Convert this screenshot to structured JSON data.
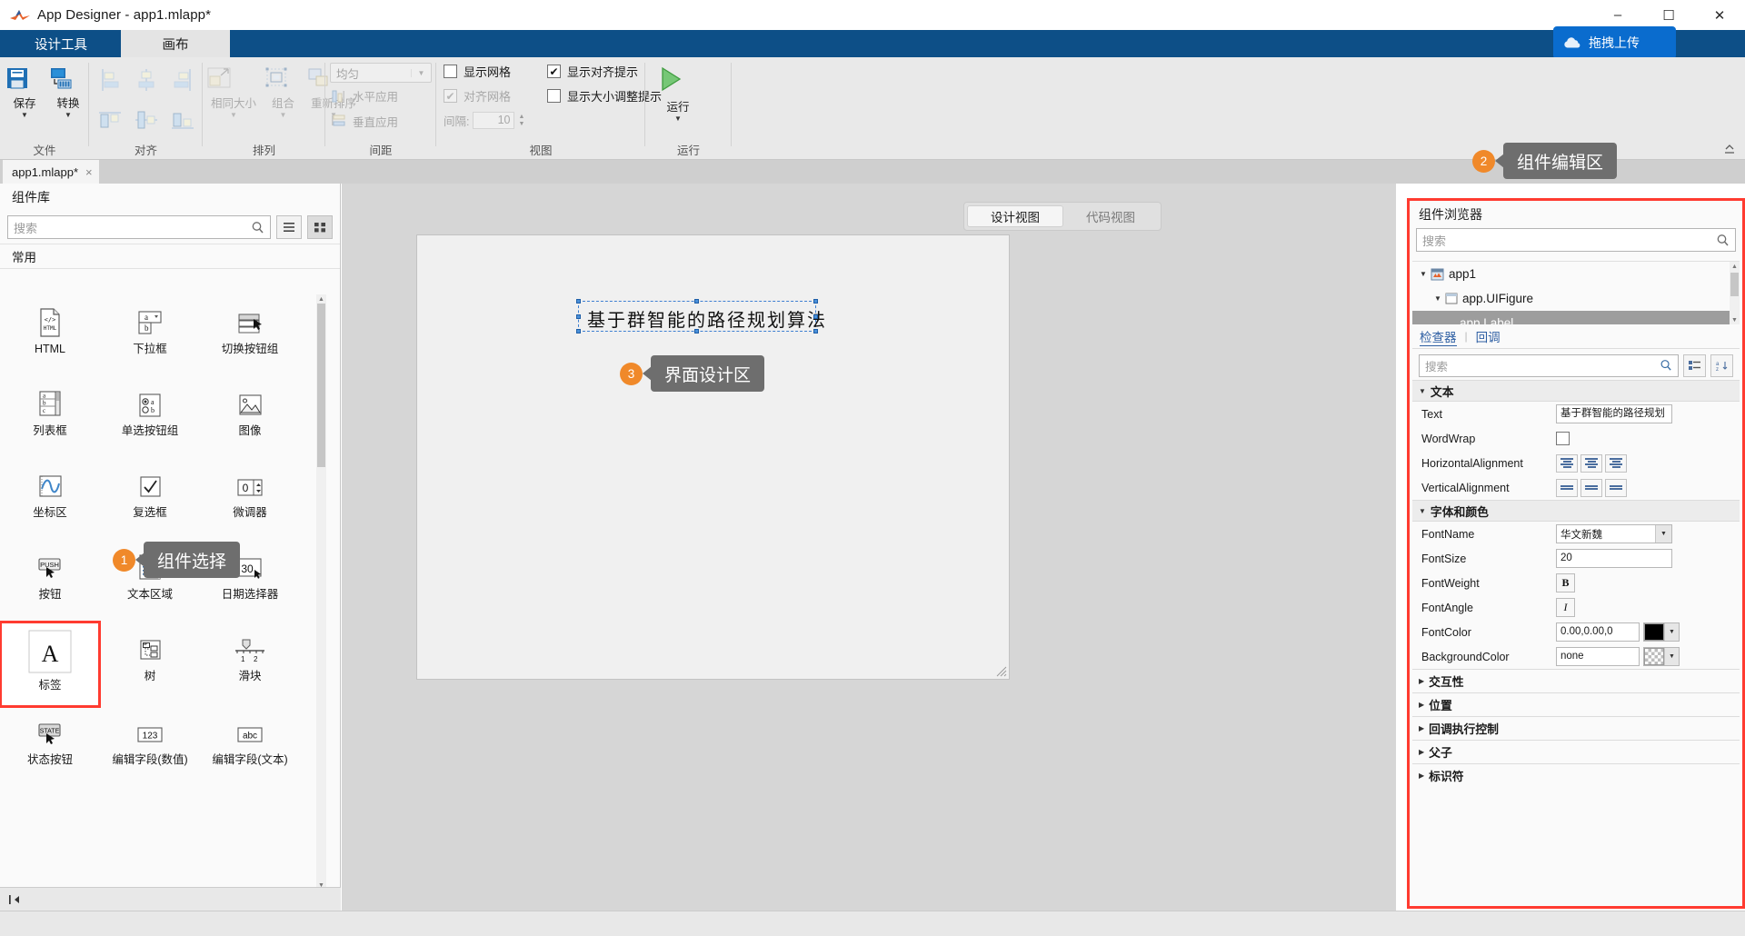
{
  "window": {
    "title": "App Designer - app1.mlapp*",
    "app_icon": "matlab-icon",
    "minimize": "–",
    "maximize": "☐",
    "close": "✕"
  },
  "ribbon": {
    "tabs": [
      {
        "label": "设计工具",
        "active": false
      },
      {
        "label": "画布",
        "active": true
      }
    ],
    "groups": [
      {
        "name": "文件",
        "items": [
          {
            "label": "保存",
            "icon": "save-icon",
            "caret": true,
            "disabled": false
          },
          {
            "label": "转换",
            "icon": "convert-icon",
            "caret": true,
            "disabled": false
          }
        ]
      },
      {
        "name": "对齐",
        "items": [
          {
            "label": "",
            "icon": "align-left-icon",
            "disabled": true
          },
          {
            "label": "",
            "icon": "align-center-icon",
            "disabled": true
          },
          {
            "label": "",
            "icon": "align-right-icon",
            "disabled": true
          },
          {
            "label": "",
            "icon": "align-top-icon",
            "disabled": true
          },
          {
            "label": "",
            "icon": "align-middle-icon",
            "disabled": true
          },
          {
            "label": "",
            "icon": "align-bottom-icon",
            "disabled": true
          }
        ]
      },
      {
        "name": "排列",
        "items": [
          {
            "label": "相同大小",
            "icon": "same-size-icon",
            "caret": true,
            "disabled": true
          },
          {
            "label": "组合",
            "icon": "group-icon",
            "caret": true,
            "disabled": true
          },
          {
            "label": "重新排序",
            "icon": "reorder-icon",
            "caret": true,
            "disabled": true
          }
        ]
      },
      {
        "name": "间距",
        "dropdown_value": "均匀",
        "items": [
          {
            "label": "水平应用",
            "icon": "apply-horizontal-icon",
            "disabled": true
          },
          {
            "label": "垂直应用",
            "icon": "apply-vertical-icon",
            "disabled": true
          }
        ]
      },
      {
        "name": "视图",
        "checkboxes": [
          {
            "label": "显示网格",
            "checked": false,
            "disabled": false
          },
          {
            "label": "对齐网格",
            "checked": true,
            "disabled": true
          },
          {
            "label": "显示对齐提示",
            "checked": true,
            "disabled": false
          },
          {
            "label": "显示大小调整提示",
            "checked": false,
            "disabled": false
          }
        ],
        "spacing": {
          "label": "间隔:",
          "value": "10"
        }
      },
      {
        "name": "运行",
        "items": [
          {
            "label": "运行",
            "icon": "run-play-icon",
            "caret": true,
            "disabled": false
          }
        ]
      }
    ],
    "right_actions": [
      {
        "icon": "share-icon"
      },
      {
        "icon": "question-icon"
      }
    ],
    "upload_button": {
      "label": "拖拽上传",
      "icon": "cloud-upload-icon",
      "color": "#0a6cce"
    }
  },
  "doc_tab": {
    "label": "app1.mlapp*",
    "close": "×"
  },
  "component_library": {
    "title": "组件库",
    "search_placeholder": "搜索",
    "search_value": "",
    "view_list_icon": "list-view-icon",
    "view_grid_icon": "grid-view-icon",
    "section_label": "常用",
    "components": [
      {
        "label": "HTML",
        "icon": "html-icon",
        "selected": false
      },
      {
        "label": "下拉框",
        "icon": "dropdown-icon",
        "selected": false
      },
      {
        "label": "切换按钮组",
        "icon": "toggle-button-group-icon",
        "selected": false
      },
      {
        "label": "列表框",
        "icon": "listbox-icon",
        "selected": false
      },
      {
        "label": "单选按钮组",
        "icon": "radio-button-group-icon",
        "selected": false
      },
      {
        "label": "图像",
        "icon": "image-icon",
        "selected": false
      },
      {
        "label": "坐标区",
        "icon": "axes-icon",
        "selected": false
      },
      {
        "label": "复选框",
        "icon": "checkbox-icon",
        "selected": false
      },
      {
        "label": "微调器",
        "icon": "spinner-icon",
        "selected": false
      },
      {
        "label": "按钮",
        "icon": "push-button-icon",
        "selected": false
      },
      {
        "label": "文本区域",
        "icon": "text-area-icon",
        "selected": false
      },
      {
        "label": "日期选择器",
        "icon": "date-picker-icon",
        "selected": false
      },
      {
        "label": "标签",
        "icon": "label-icon",
        "selected": true
      },
      {
        "label": "树",
        "icon": "tree-icon",
        "selected": false
      },
      {
        "label": "滑块",
        "icon": "slider-icon",
        "selected": false
      },
      {
        "label": "状态按钮",
        "icon": "state-button-icon",
        "selected": false
      },
      {
        "label": "编辑字段(数值)",
        "icon": "numeric-edit-field-icon",
        "selected": false
      },
      {
        "label": "编辑字段(文本)",
        "icon": "text-edit-field-icon",
        "selected": false
      }
    ]
  },
  "canvas": {
    "view_tabs": [
      {
        "label": "设计视图",
        "active": true
      },
      {
        "label": "代码视图",
        "active": false
      }
    ],
    "figure_label_text": "基于群智能的路径规划算法"
  },
  "component_browser": {
    "title": "组件浏览器",
    "search_placeholder": "搜索",
    "search_value": "",
    "tree": [
      {
        "label": "app1",
        "depth": 0,
        "caret": "▼",
        "icon": "app-icon",
        "selected": false
      },
      {
        "label": "app.UIFigure",
        "depth": 1,
        "caret": "▼",
        "icon": "figure-icon",
        "selected": false
      },
      {
        "label": "app.Label",
        "depth": 2,
        "caret": "",
        "icon": "",
        "selected": true
      }
    ],
    "inspector_tabs": [
      {
        "label": "检查器",
        "active": true
      },
      {
        "label": "回调",
        "active": false
      }
    ],
    "prop_search_placeholder": "搜索",
    "prop_search_value": "",
    "prop_sort_icon": "sort-category-icon",
    "prop_az_icon": "sort-alpha-icon",
    "sections": [
      {
        "name": "文本",
        "expanded": true,
        "rows": [
          {
            "name": "Text",
            "type": "text",
            "value": "基于群智能的路径规划"
          },
          {
            "name": "WordWrap",
            "type": "checkbox",
            "value": false
          },
          {
            "name": "HorizontalAlignment",
            "type": "align3",
            "value": "center"
          },
          {
            "name": "VerticalAlignment",
            "type": "valign3",
            "value": "middle"
          }
        ]
      },
      {
        "name": "字体和颜色",
        "expanded": true,
        "rows": [
          {
            "name": "FontName",
            "type": "combo",
            "value": "华文新魏"
          },
          {
            "name": "FontSize",
            "type": "text",
            "value": "20"
          },
          {
            "name": "FontWeight",
            "type": "bold",
            "value": "B"
          },
          {
            "name": "FontAngle",
            "type": "italic",
            "value": "I"
          },
          {
            "name": "FontColor",
            "type": "color",
            "value": "0.00,0.00,0",
            "swatch": "#000000"
          },
          {
            "name": "BackgroundColor",
            "type": "color",
            "value": "none",
            "swatch": "transparent"
          }
        ]
      },
      {
        "name": "交互性",
        "expanded": false,
        "rows": []
      },
      {
        "name": "位置",
        "expanded": false,
        "rows": []
      },
      {
        "name": "回调执行控制",
        "expanded": false,
        "rows": []
      },
      {
        "name": "父子",
        "expanded": false,
        "rows": []
      },
      {
        "name": "标识符",
        "expanded": false,
        "rows": []
      }
    ]
  },
  "callouts": [
    {
      "num": "1",
      "label": "组件选择"
    },
    {
      "num": "2",
      "label": "组件编辑区"
    },
    {
      "num": "3",
      "label": "界面设计区"
    }
  ],
  "colors": {
    "ribbon_blue": "#0d4f87",
    "highlight_red": "#ff3b30",
    "callout_orange": "#f0892a",
    "selection_blue": "#4a90d9"
  }
}
